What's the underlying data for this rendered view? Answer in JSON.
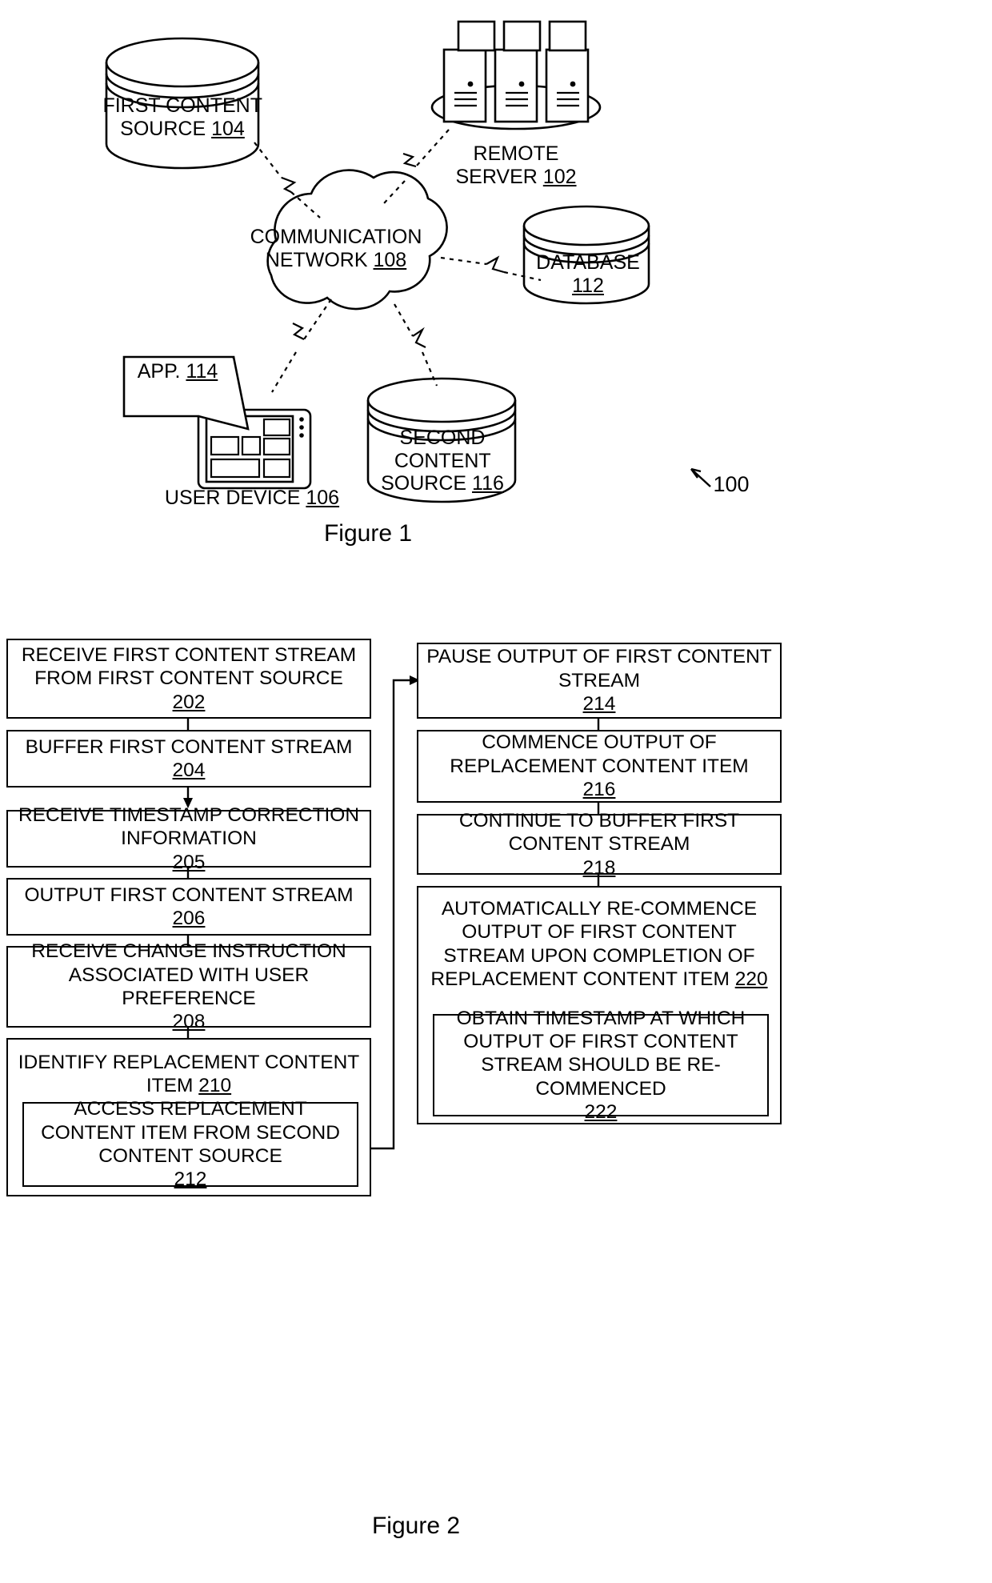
{
  "figure1": {
    "caption": "Figure 1",
    "ref_label": "100",
    "nodes": {
      "first_content_source": {
        "lines": [
          "FIRST",
          "CONTENT",
          "SOURCE"
        ],
        "ref": "104",
        "shape": "cylinder"
      },
      "remote_server": {
        "lines": [
          "REMOTE",
          "SERVER"
        ],
        "ref": "102",
        "shape": "server-rack"
      },
      "communication_network": {
        "lines": [
          "COMMUNICATION",
          "NETWORK"
        ],
        "ref": "108",
        "shape": "cloud"
      },
      "database": {
        "lines": [
          "DATABASE"
        ],
        "ref": "112",
        "shape": "cylinder"
      },
      "user_device": {
        "lines": [
          "USER DEVICE"
        ],
        "ref": "106",
        "shape": "tablet"
      },
      "app": {
        "lines": [
          "APP."
        ],
        "ref": "114",
        "shape": "callout"
      },
      "second_content_source": {
        "lines": [
          "SECOND",
          "CONTENT",
          "SOURCE"
        ],
        "ref": "116",
        "shape": "cylinder"
      }
    },
    "connections": [
      {
        "from": "first_content_source",
        "to": "communication_network",
        "style": "dashed-zigzag"
      },
      {
        "from": "remote_server",
        "to": "communication_network",
        "style": "dashed-zigzag"
      },
      {
        "from": "communication_network",
        "to": "database",
        "style": "dashed-zigzag"
      },
      {
        "from": "communication_network",
        "to": "user_device",
        "style": "dashed-zigzag"
      },
      {
        "from": "communication_network",
        "to": "second_content_source",
        "style": "dashed-zigzag"
      }
    ]
  },
  "figure2": {
    "caption": "Figure 2",
    "left_column": [
      {
        "text": "RECEIVE FIRST CONTENT STREAM FROM FIRST CONTENT SOURCE",
        "ref": "202"
      },
      {
        "text": "BUFFER FIRST CONTENT STREAM",
        "ref": "204"
      },
      {
        "text": "RECEIVE TIMESTAMP CORRECTION INFORMATION",
        "ref": "205"
      },
      {
        "text": "OUTPUT FIRST CONTENT STREAM",
        "ref": "206"
      },
      {
        "text": "RECEIVE CHANGE INSTRUCTION ASSOCIATED WITH USER PREFERENCE",
        "ref": "208"
      },
      {
        "text": "IDENTIFY REPLACEMENT CONTENT ITEM",
        "ref": "210"
      },
      {
        "text": "ACCESS REPLACEMENT CONTENT ITEM FROM SECOND CONTENT SOURCE",
        "ref": "212",
        "nested": true
      }
    ],
    "right_column": [
      {
        "text": "PAUSE OUTPUT OF FIRST CONTENT STREAM",
        "ref": "214"
      },
      {
        "text": "COMMENCE OUTPUT OF REPLACEMENT CONTENT ITEM",
        "ref": "216"
      },
      {
        "text": "CONTINUE TO BUFFER FIRST CONTENT STREAM",
        "ref": "218"
      },
      {
        "text": "AUTOMATICALLY RE-COMMENCE OUTPUT OF FIRST CONTENT STREAM UPON COMPLETION OF REPLACEMENT CONTENT ITEM",
        "ref": "220"
      },
      {
        "text": "OBTAIN TIMESTAMP AT WHICH OUTPUT OF FIRST CONTENT STREAM SHOULD BE RE-COMMENCED",
        "ref": "222",
        "nested": true
      }
    ]
  }
}
